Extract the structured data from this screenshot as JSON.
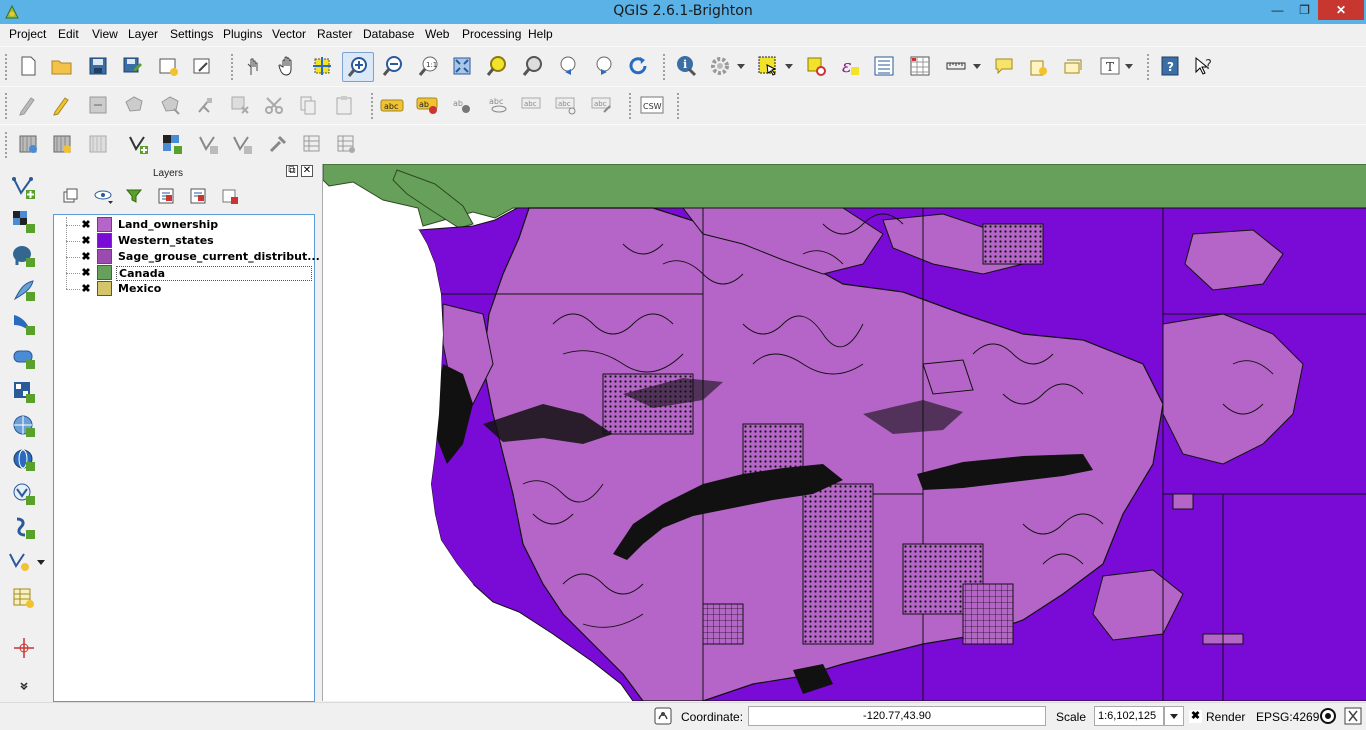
{
  "window": {
    "title": "QGIS 2.6.1-Brighton",
    "controls": {
      "minimize": "—",
      "maximize": "❐",
      "close": "✕"
    }
  },
  "menu": [
    "Project",
    "Edit",
    "View",
    "Layer",
    "Settings",
    "Plugins",
    "Vector",
    "Raster",
    "Database",
    "Web",
    "Processing",
    "Help"
  ],
  "toolbar": {
    "csw_label": "CSW",
    "label_tool_text": "abc"
  },
  "layers_panel": {
    "title": "Layers",
    "float_button": "⧉",
    "close_button": "✕",
    "layers": [
      {
        "name": "Land_ownership",
        "checked": "✖",
        "color": "#b565c7"
      },
      {
        "name": "Western_states",
        "checked": "✖",
        "color": "#7a0ad6"
      },
      {
        "name": "Sage_grouse_current_distribut...",
        "checked": "✖",
        "color": "#9b4ab0"
      },
      {
        "name": "Canada",
        "checked": "✖",
        "color": "#66a05a"
      },
      {
        "name": "Mexico",
        "checked": "✖",
        "color": "#d4c46a"
      }
    ]
  },
  "map": {
    "canada_color": "#66a05a",
    "states_color": "#7a0ad6",
    "ownership_color": "#b565c7",
    "grouse_color": "#111111"
  },
  "status": {
    "coordinate_label": "Coordinate:",
    "coordinate_value": "-120.77,43.90",
    "scale_label": "Scale",
    "scale_value": "1:6,102,125",
    "render_label": "Render",
    "render_checked": "✖",
    "crs": "EPSG:4269"
  }
}
